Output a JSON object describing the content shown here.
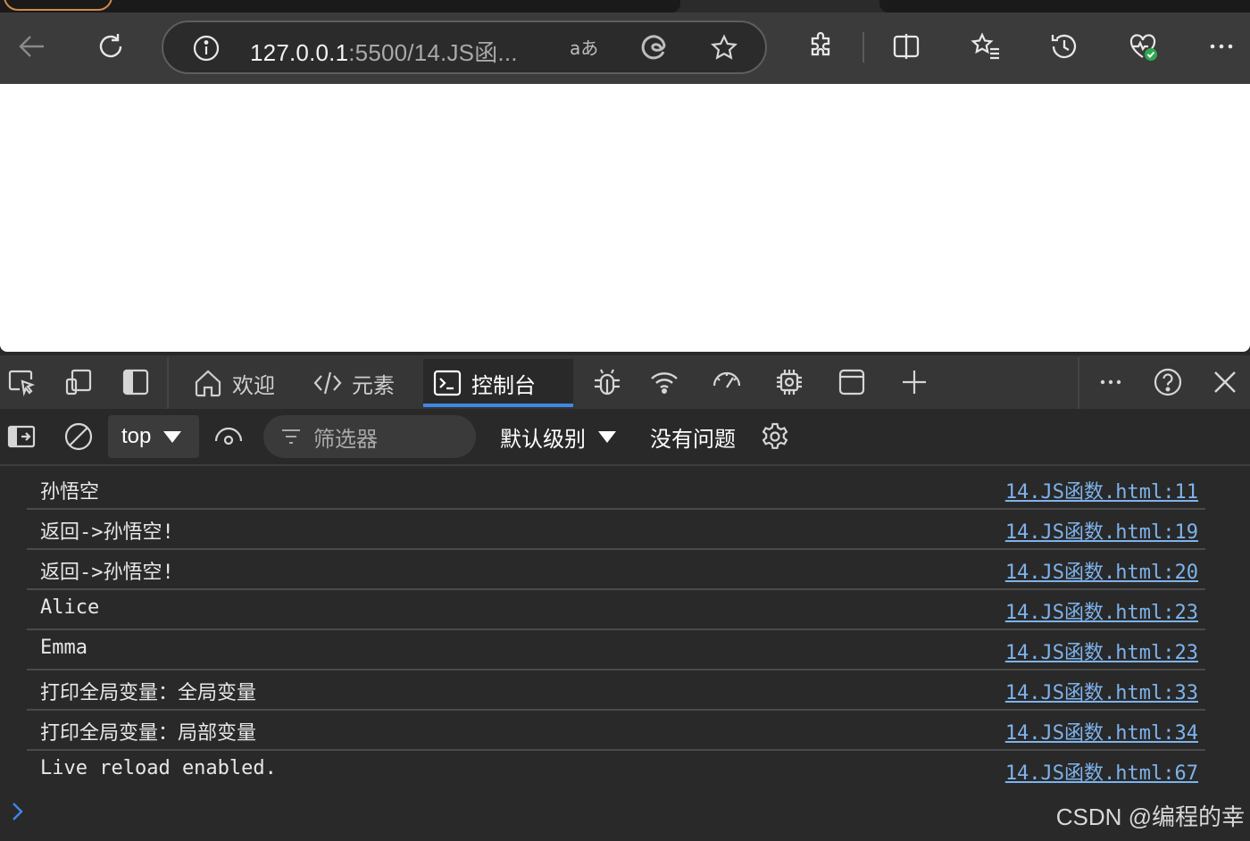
{
  "browser": {
    "url_host": "127.0.0.1",
    "url_rest": ":5500/14.JS函...",
    "icons": [
      "back-arrow-icon",
      "refresh-icon",
      "info-icon",
      "read-aloud-icon",
      "edge-icon",
      "star-icon",
      "extensions-icon",
      "split-screen-icon",
      "favorites-icon",
      "history-icon",
      "browser-essentials-icon",
      "more-icon"
    ]
  },
  "devtools": {
    "tabs": {
      "welcome": "欢迎",
      "elements": "元素",
      "console": "控制台"
    },
    "toolbar": {
      "context": "top",
      "filter_placeholder": "筛选器",
      "level": "默认级别",
      "issues": "没有问题"
    },
    "accent_color": "#3f87e6",
    "link_color": "#7eb3ec"
  },
  "console": {
    "rows": [
      {
        "message": "孙悟空",
        "source": "14.JS函数.html:11"
      },
      {
        "message": "返回->孙悟空!",
        "source": "14.JS函数.html:19"
      },
      {
        "message": "返回->孙悟空!",
        "source": "14.JS函数.html:20"
      },
      {
        "message": "Alice",
        "source": "14.JS函数.html:23"
      },
      {
        "message": "Emma",
        "source": "14.JS函数.html:23"
      },
      {
        "message": "打印全局变量：全局变量",
        "source": "14.JS函数.html:33"
      },
      {
        "message": "打印全局变量：局部变量",
        "source": "14.JS函数.html:34"
      },
      {
        "message": "Live reload enabled.",
        "source": "14.JS函数.html:67"
      }
    ]
  },
  "watermark": "CSDN @编程的幸"
}
